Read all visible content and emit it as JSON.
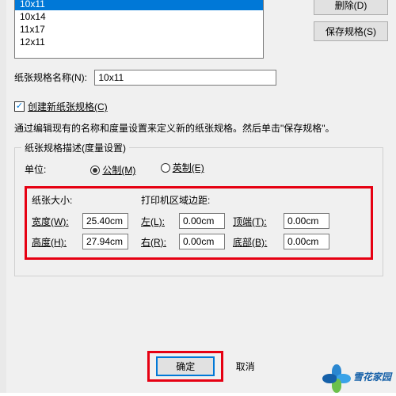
{
  "list": {
    "i0": "10x11",
    "i1": "10x14",
    "i2": "11x17",
    "i3": "12x11"
  },
  "buttons": {
    "delete": "删除(D)",
    "save": "保存规格(S)",
    "ok": "确定",
    "cancel": "取消"
  },
  "nameRow": {
    "label": "纸张规格名称(N):",
    "value": "10x11"
  },
  "create": {
    "label": "创建新纸张规格(C)"
  },
  "note": "通过编辑现有的名称和度量设置来定义新的纸张规格。然后单击\"保存规格\"。",
  "fs": {
    "legend": "纸张规格描述(度量设置)",
    "unitsLabel": "单位:",
    "metric": "公制(M)",
    "imperial": "英制(E)",
    "sizeHd": "纸张大小:",
    "marginHd": "打印机区域边距:",
    "wLabel": "宽度(W):",
    "wVal": "25.40cm",
    "hLabel": "高度(H):",
    "hVal": "27.94cm",
    "lLabel": "左(L):",
    "lVal": "0.00cm",
    "rLabel": "右(R):",
    "rVal": "0.00cm",
    "tLabel": "顶端(T):",
    "tVal": "0.00cm",
    "bLabel": "底部(B):",
    "bVal": "0.00cm"
  },
  "watermark": "雪花家园"
}
